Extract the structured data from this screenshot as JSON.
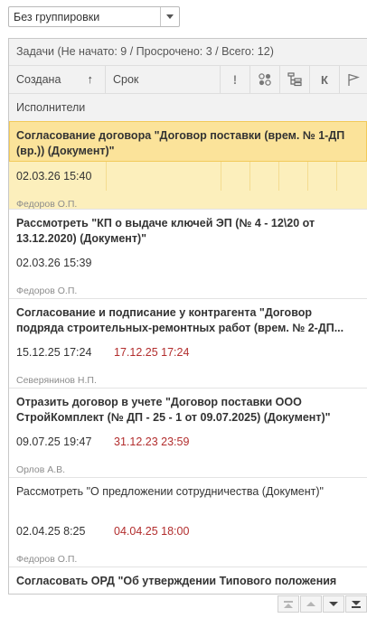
{
  "grouping": {
    "value": "Без группировки"
  },
  "summary": "Задачи (Не начато: 9 / Просрочено: 3 / Всего: 12)",
  "columns": {
    "created": "Создана",
    "sort_arrow": "↑",
    "deadline": "Срок",
    "importance": "!",
    "control": "К",
    "executors": "Исполнители"
  },
  "icons": [
    "importance-icon",
    "status-icon",
    "hierarchy-icon",
    "control-icon",
    "flag-icon"
  ],
  "colors": {
    "selected_bg": "#fcefbc",
    "overdue": "#b22d2d",
    "header_bg": "#f2f2f2"
  },
  "tasks": [
    {
      "title": "Согласование договора \"Договор поставки (врем. № 1-ДП (вр.)) (Документ)\"",
      "created": "02.03.26 15:40",
      "deadline": "",
      "executor": "Федоров О.П.",
      "selected": true,
      "bold": true
    },
    {
      "title": "Рассмотреть \"КП о выдаче ключей ЭП (№ 4 - 12\\20 от 13.12.2020) (Документ)\"",
      "created": "02.03.26 15:39",
      "deadline": "",
      "executor": "Федоров О.П.",
      "bold": true
    },
    {
      "title": "Согласование и подписание у контрагента \"Договор подряда строительных-ремонтных работ (врем. № 2-ДП...",
      "created": "15.12.25 17:24",
      "deadline": "17.12.25 17:24",
      "executor": "Северянинов Н.П.",
      "bold": true
    },
    {
      "title": "Отразить договор в учете \"Договор поставки ООО СтройКомплект (№ ДП - 25 - 1 от 09.07.2025) (Документ)\"",
      "created": "09.07.25 19:47",
      "deadline": "31.12.23 23:59",
      "executor": "Орлов А.В.",
      "bold": true
    },
    {
      "title": "Рассмотреть \"О предложении сотрудничества (Документ)\"",
      "created": "02.04.25 8:25",
      "deadline": "04.04.25 18:00",
      "executor": "Федоров О.П.",
      "bold": false
    },
    {
      "title": "Согласовать ОРД \"Об утверждении Типового положения",
      "created": "",
      "deadline": "",
      "executor": "",
      "bold": true
    }
  ]
}
